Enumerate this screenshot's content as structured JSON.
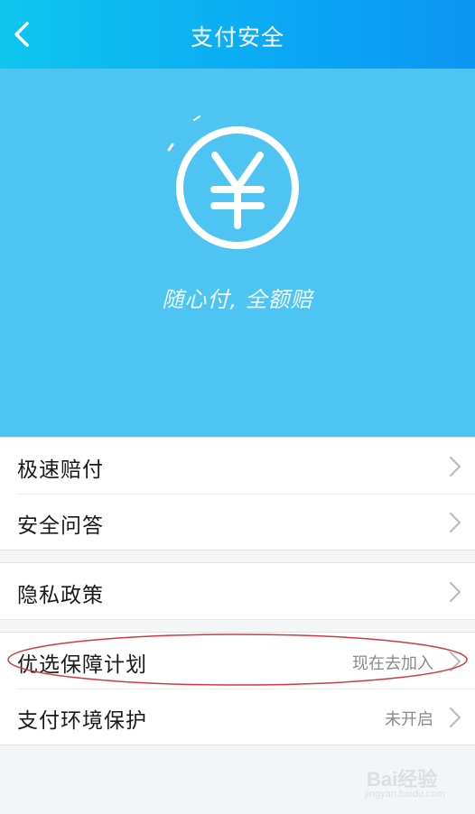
{
  "header": {
    "back_icon": "chevron-left-icon",
    "title": "支付安全"
  },
  "hero": {
    "icon": "yuan-coin-icon",
    "slogan": "随心付, 全额赔"
  },
  "groups": [
    {
      "items": [
        {
          "label": "极速赔付",
          "value": ""
        },
        {
          "label": "安全问答",
          "value": ""
        }
      ]
    },
    {
      "items": [
        {
          "label": "隐私政策",
          "value": ""
        }
      ]
    },
    {
      "items": [
        {
          "label": "优选保障计划",
          "value": "现在去加入"
        },
        {
          "label": "支付环境保护",
          "value": "未开启"
        }
      ]
    }
  ],
  "colors": {
    "nav_gradient_start": "#0fc6ee",
    "nav_gradient_end": "#0c95f3",
    "hero_bg": "#4ec4f2",
    "annotation_ellipse": "#d23a3a"
  },
  "watermark": {
    "brand": "Bai经验",
    "sub": "jingyan.baidu.com"
  }
}
